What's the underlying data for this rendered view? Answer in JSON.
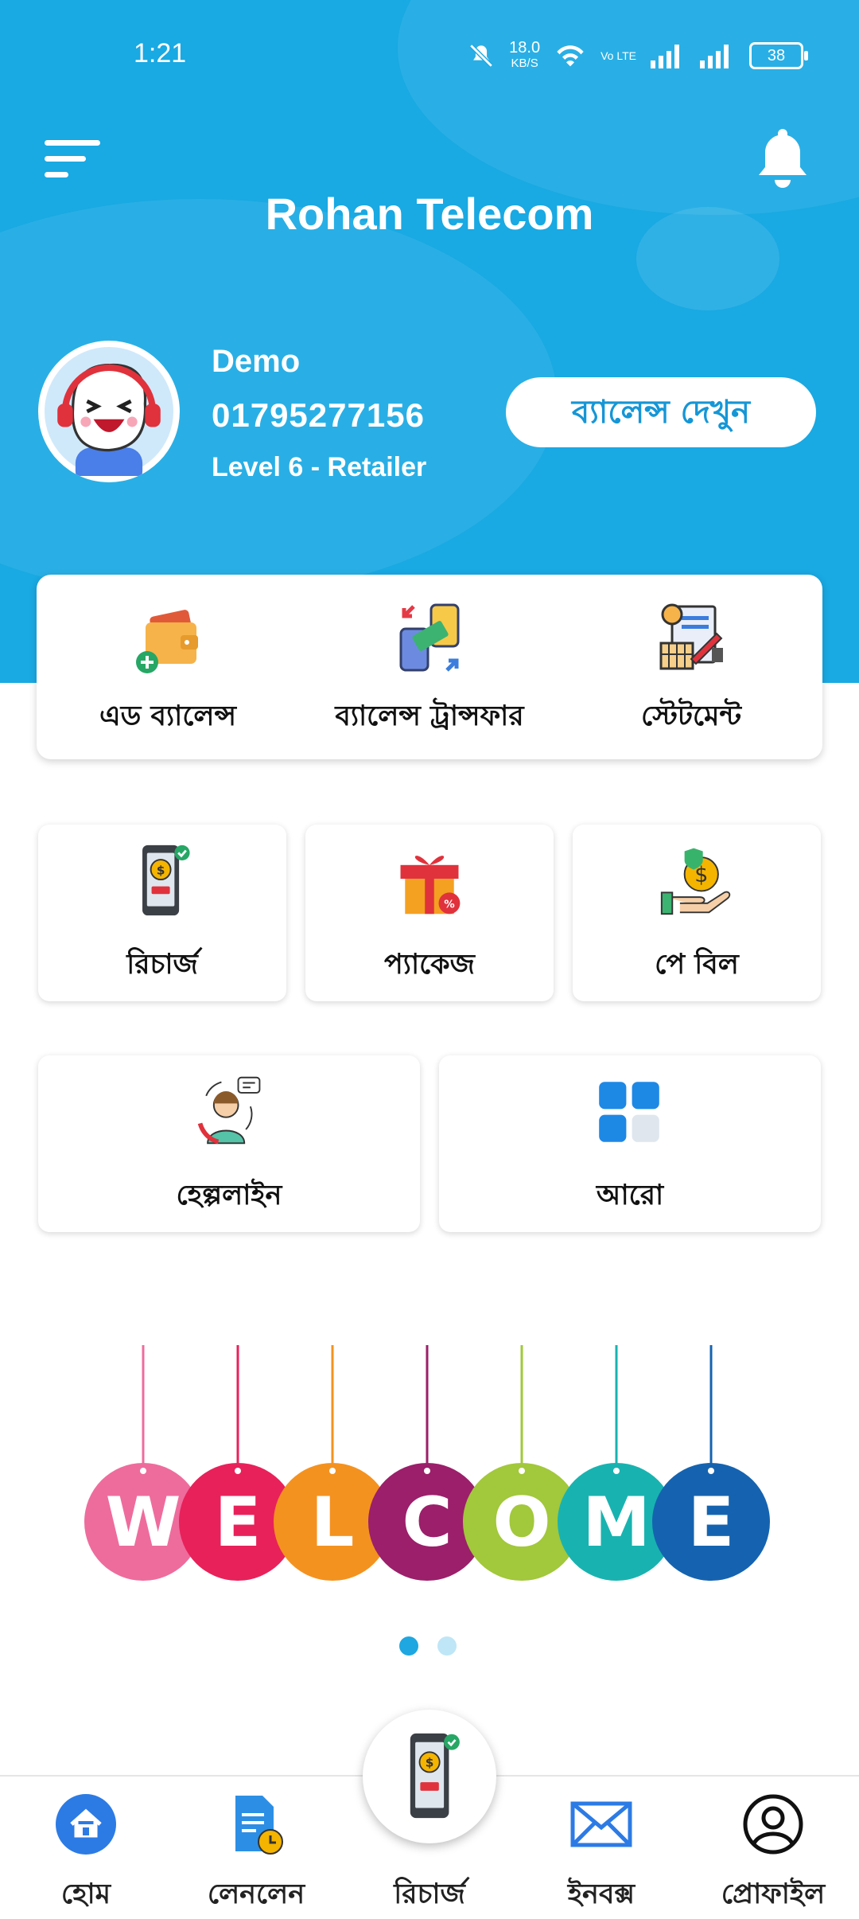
{
  "status_bar": {
    "time": "1:21",
    "net_speed": "18.0",
    "net_unit": "KB/S",
    "battery": "38",
    "volte": "Vo LTE"
  },
  "header": {
    "title": "Rohan Telecom"
  },
  "user": {
    "name": "Demo",
    "phone": "01795277156",
    "level": "Level 6 - Retailer",
    "balance_button": "ব্যালেন্স দেখুন"
  },
  "quick_actions": [
    {
      "label": "এড ব্যালেন্স",
      "icon": "wallet-add-icon"
    },
    {
      "label": "ব্যালেন্স ট্রান্সফার",
      "icon": "transfer-icon"
    },
    {
      "label": "স্টেটমেন্ট",
      "icon": "statement-icon"
    }
  ],
  "services": [
    {
      "label": "রিচার্জ",
      "icon": "recharge-phone-icon"
    },
    {
      "label": "প্যাকেজ",
      "icon": "gift-package-icon"
    },
    {
      "label": "পে বিল",
      "icon": "pay-bill-icon"
    },
    {
      "label": "হেল্পলাইন",
      "icon": "helpline-icon"
    },
    {
      "label": "আরো",
      "icon": "grid-more-icon"
    }
  ],
  "banner": {
    "letters": [
      "W",
      "E",
      "L",
      "C",
      "O",
      "M",
      "E"
    ],
    "colors": [
      "#ee6c9c",
      "#e8215a",
      "#f4921f",
      "#9b1f6a",
      "#a2c83b",
      "#18b3b0",
      "#1563b0"
    ],
    "active_dot": 0,
    "dot_count": 2
  },
  "bottom_nav": [
    {
      "label": "হোম",
      "icon": "home-icon",
      "active": true
    },
    {
      "label": "লেনলেন",
      "icon": "transactions-icon"
    },
    {
      "label": "রিচার্জ",
      "icon": "recharge-phone-icon"
    },
    {
      "label": "ইনবক্স",
      "icon": "mail-icon"
    },
    {
      "label": "প্রোফাইল",
      "icon": "user-icon"
    }
  ],
  "colors": {
    "primary": "#19a9e3",
    "accent": "#1596d6",
    "nav_active": "#2c7be5"
  }
}
